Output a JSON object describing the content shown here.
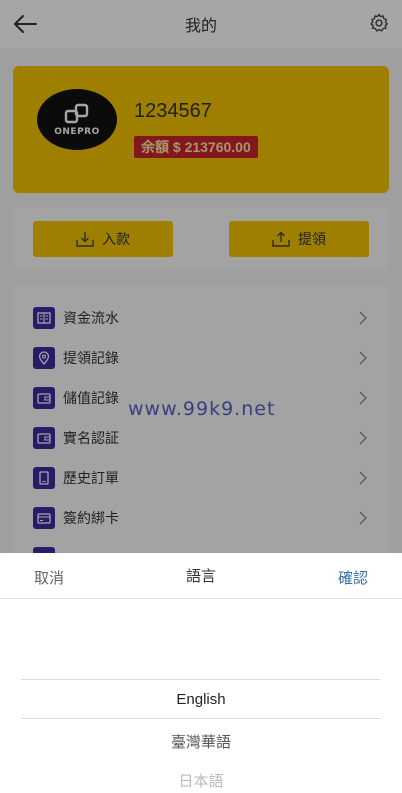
{
  "header": {
    "title": "我的"
  },
  "account": {
    "logo_text": "ONEPRO",
    "user_id": "1234567",
    "balance_label": "余額 $  213760.00"
  },
  "actions": {
    "deposit": "入款",
    "withdraw": "提領"
  },
  "menu": {
    "items": [
      {
        "label": "資金流水",
        "icon": "ledger-icon"
      },
      {
        "label": "提領記錄",
        "icon": "location-pin-icon"
      },
      {
        "label": "儲值記錄",
        "icon": "wallet-icon"
      },
      {
        "label": "實名認証",
        "icon": "wallet-icon"
      },
      {
        "label": "歷史訂單",
        "icon": "document-icon"
      },
      {
        "label": "簽約綁卡",
        "icon": "card-icon"
      }
    ]
  },
  "watermark": "www.99k9.net",
  "language_picker": {
    "cancel": "取消",
    "title": "語言",
    "confirm": "確認",
    "options": [
      "English",
      "臺灣華語",
      "日本語"
    ],
    "selected": "English"
  },
  "colors": {
    "accent": "#f3c300",
    "badge": "#c9242f",
    "icon_bg": "#3d2c9e",
    "confirm": "#3a6fa8"
  }
}
